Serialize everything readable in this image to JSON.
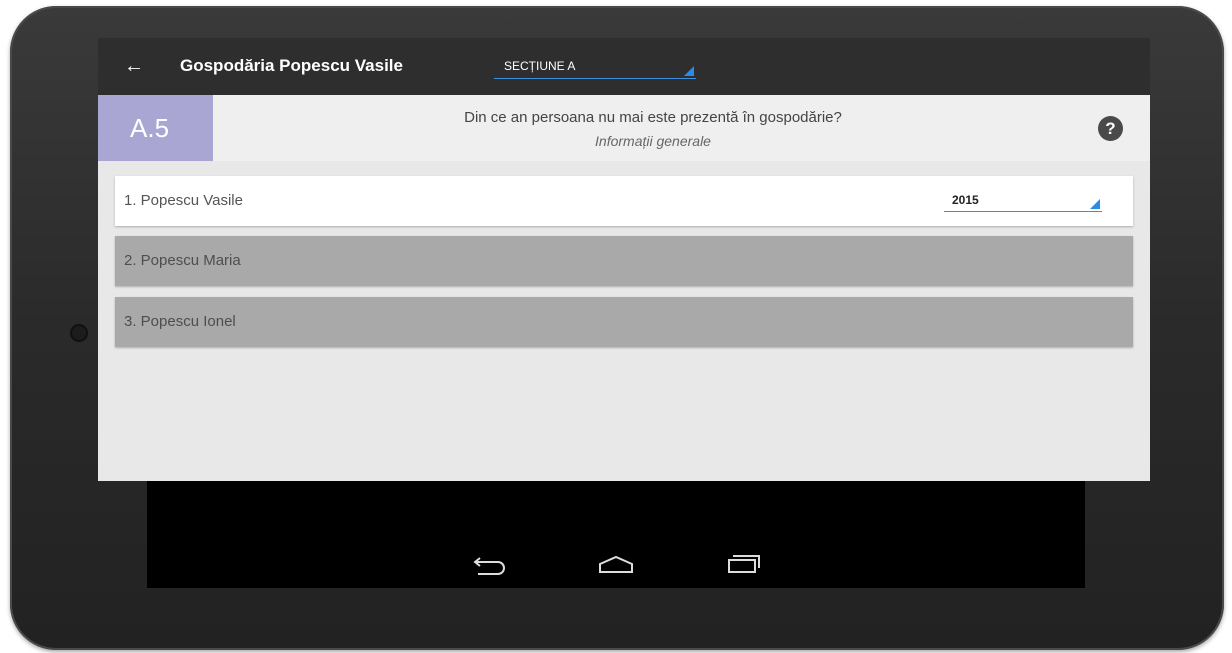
{
  "app": {
    "title": "Gospodăria Popescu Vasile",
    "section_select": {
      "value": "SECȚIUNE A"
    }
  },
  "question": {
    "code": "A.5",
    "text": "Din ce an persoana nu mai este prezentă în gospodărie?",
    "subtitle": "Informații generale"
  },
  "rows": [
    {
      "label": "1. Popescu Vasile",
      "year": "2015",
      "active": true
    },
    {
      "label": "2. Popescu Maria",
      "active": false
    },
    {
      "label": "3. Popescu Ionel",
      "active": false
    }
  ],
  "icons": {
    "back": "arrow-left-icon",
    "help": "question-circle-icon",
    "nav": [
      "back-nav-icon",
      "home-nav-icon",
      "recent-apps-icon"
    ]
  },
  "colors": {
    "topbar": "#2e2e2e",
    "question_code_bg": "#a9a6d4",
    "accent_blue": "#2b8be6",
    "disabled_row": "#a9a9a9"
  }
}
